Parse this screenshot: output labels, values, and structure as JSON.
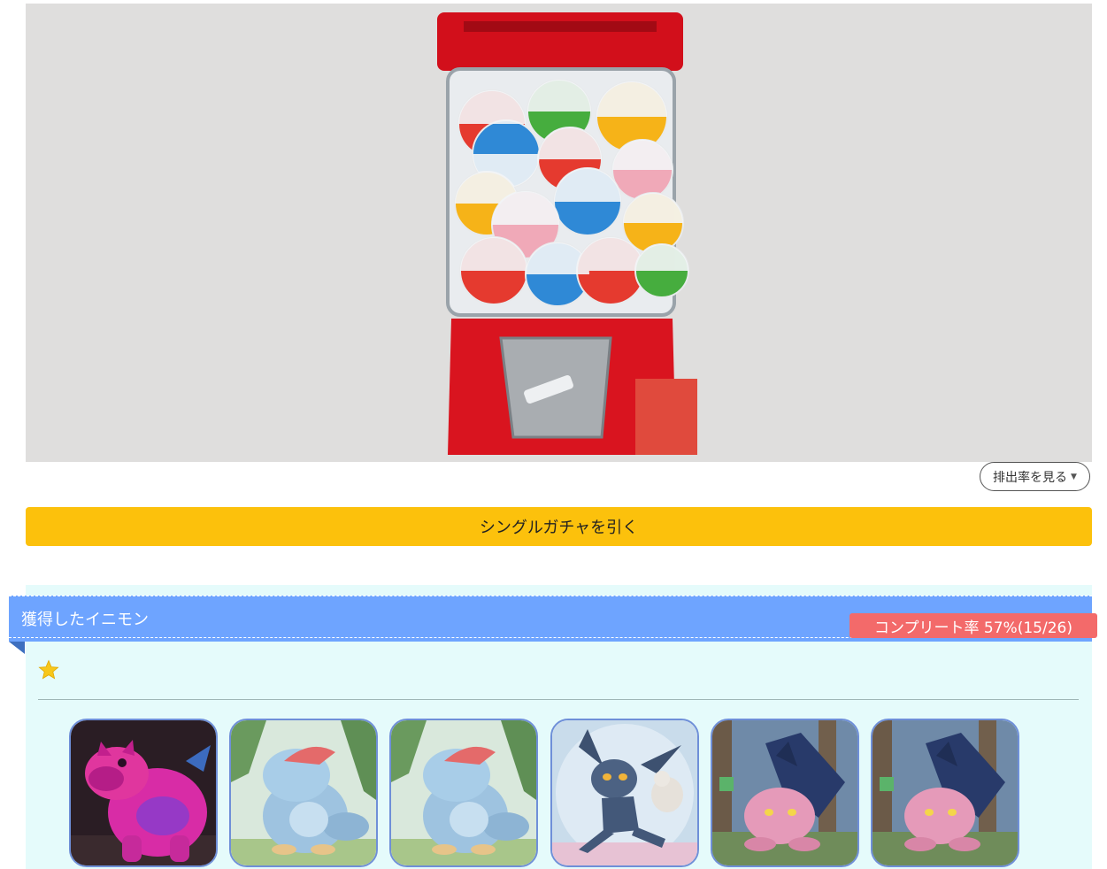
{
  "hero": {
    "image": "gachapon-capsule-machine"
  },
  "rate_button": {
    "label": "排出率を見る",
    "icon": "caret-down-icon"
  },
  "gacha_button": {
    "label": "シングルガチャを引く"
  },
  "collection": {
    "title": "獲得したイニモン",
    "complete_rate": "コンプリート率 57%(15/26)",
    "rarity_icon": "star-icon",
    "colors": {
      "ribbon": "#6ea4ff",
      "badge": "#f36a6a",
      "panel": "#e5fbfb",
      "button": "#fcc10c"
    },
    "cards": [
      {
        "name": "magenta-beast-monster"
      },
      {
        "name": "blue-dino-monster-jungle"
      },
      {
        "name": "blue-dino-monster-jungle"
      },
      {
        "name": "dark-imp-monster-with-bird"
      },
      {
        "name": "pink-dragon-monster-forest"
      },
      {
        "name": "pink-dragon-monster-forest"
      }
    ]
  }
}
